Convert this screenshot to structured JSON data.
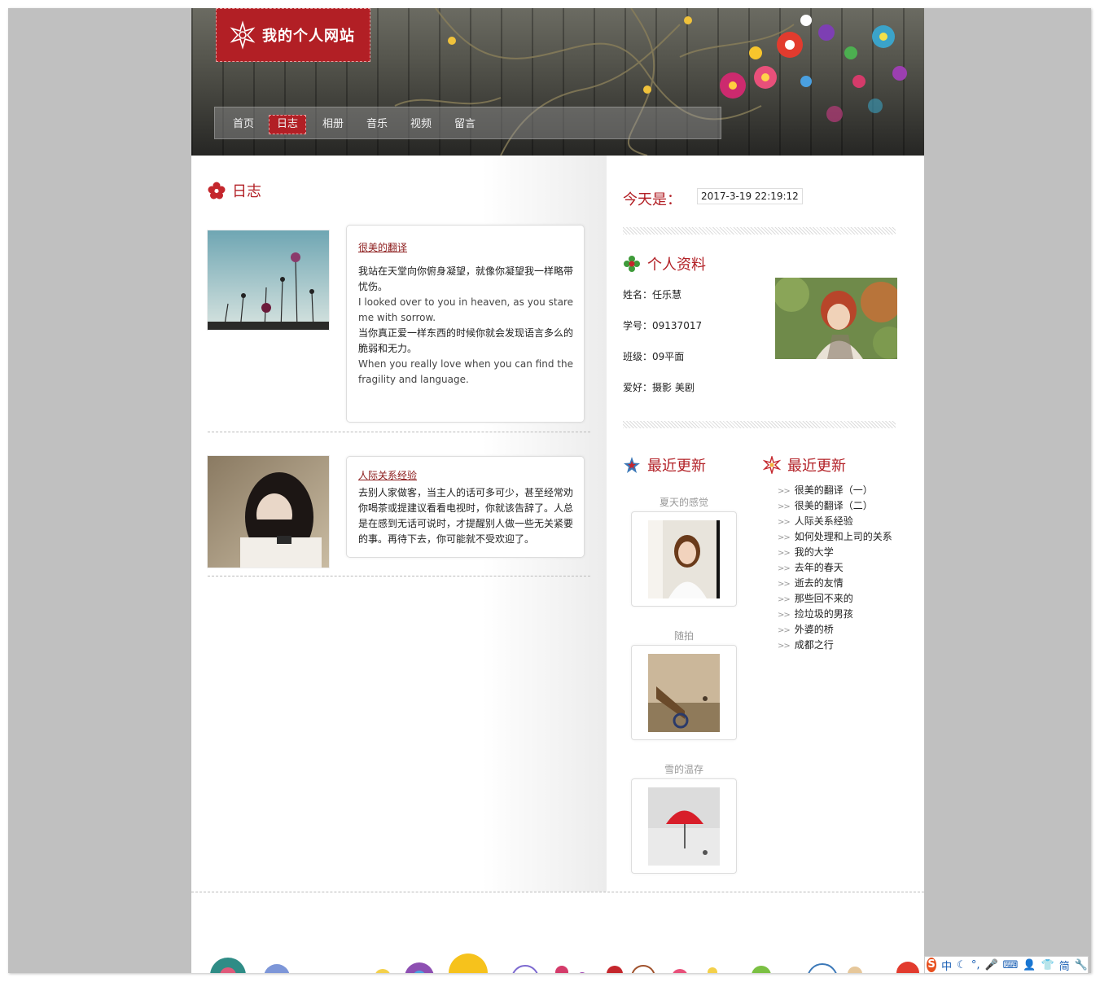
{
  "site": {
    "title": "我的个人网站",
    "nav": [
      {
        "label": "首页",
        "active": false
      },
      {
        "label": "日志",
        "active": true
      },
      {
        "label": "相册",
        "active": false
      },
      {
        "label": "音乐",
        "active": false
      },
      {
        "label": "视频",
        "active": false
      },
      {
        "label": "留言",
        "active": false
      }
    ]
  },
  "blog": {
    "title": "日志",
    "entries": [
      {
        "link": "很美的翻译",
        "paragraphs": [
          "我站在天堂向你俯身凝望，就像你凝望我一样略带忧伤。",
          "I looked over to you in heaven, as you stare me with sorrow.",
          "当你真正爱一样东西的时候你就会发现语言多么的脆弱和无力。",
          "When you really love when you can find the fragility and language."
        ]
      },
      {
        "link": "人际关系经验",
        "paragraphs": [
          "去别人家做客，当主人的话可多可少，甚至经常劝你喝茶或提建议看看电视时，你就该告辞了。人总是在感到无话可说时，才提醒别人做一些无关紧要的事。再待下去，你可能就不受欢迎了。"
        ]
      }
    ]
  },
  "sidebar": {
    "today_label": "今天是：",
    "today_value": "2017-3-19 22:19:12",
    "profile_title": "个人资料",
    "profile": [
      {
        "label": "姓名：",
        "value": "任乐慧"
      },
      {
        "label": "学号：",
        "value": "09137017"
      },
      {
        "label": "班级：",
        "value": "09平面"
      },
      {
        "label": "爱好：",
        "value": "摄影 美剧"
      }
    ],
    "photos_title": "最近更新",
    "photos": [
      {
        "caption": "夏天的感觉"
      },
      {
        "caption": "随拍"
      },
      {
        "caption": "雪的温存"
      }
    ],
    "recent_title": "最近更新",
    "recent": [
      "很美的翻译（一）",
      "很美的翻译（二）",
      "人际关系经验",
      "如何处理和上司的关系",
      "我的大学",
      "去年的春天",
      "逝去的友情",
      "那些回不来的",
      "捡垃圾的男孩",
      "外婆的桥",
      "成都之行"
    ]
  },
  "ime": {
    "items": [
      "中",
      "简"
    ]
  },
  "colors": {
    "accent": "#b21f25",
    "link": "#8b1a1a",
    "frame": "#c0c0c0"
  }
}
